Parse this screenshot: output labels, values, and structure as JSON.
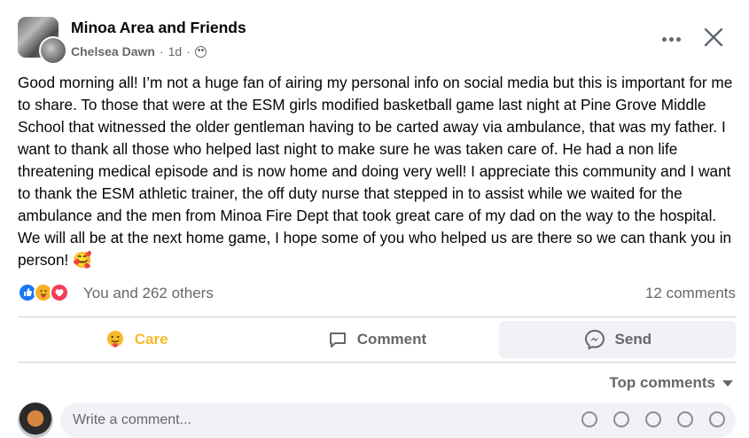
{
  "post": {
    "group_name": "Minoa Area and Friends",
    "author": "Chelsea Dawn",
    "separator": "·",
    "time": "1d",
    "body": "Good morning all! I’m not a huge fan of airing my personal info on social media but this is important for me to share. To those that were at the ESM girls modified basketball game last night at Pine Grove Middle School that witnessed the older gentleman having to be carted away via ambulance, that was my father. I want to thank all those who helped last night to make sure he was taken care of. He had a non life threatening medical episode and is now home and doing very well! I appreciate this community and I want to thank the ESM athletic trainer, the off duty nurse that stepped in to assist while we waited for the ambulance and the men from Minoa Fire Dept that took great care of my dad on the way to the hospital. We will all be at the next home game, I hope some of you who helped us are there so we can thank you in person! 🥰"
  },
  "reactions": {
    "summary": "You and 262 others",
    "comments_count": "12 comments",
    "icons": [
      "like-icon",
      "care-icon",
      "love-icon"
    ],
    "colors": {
      "like": "#1877f2",
      "care": "#f7b125",
      "love": "#f33e58"
    }
  },
  "actions": {
    "care_label": "Care",
    "comment_label": "Comment",
    "send_label": "Send"
  },
  "comments": {
    "sort_label": "Top comments",
    "composer_placeholder": "Write a comment..."
  },
  "colors": {
    "care_text": "#f7b928",
    "secondary_text": "#65676b"
  }
}
